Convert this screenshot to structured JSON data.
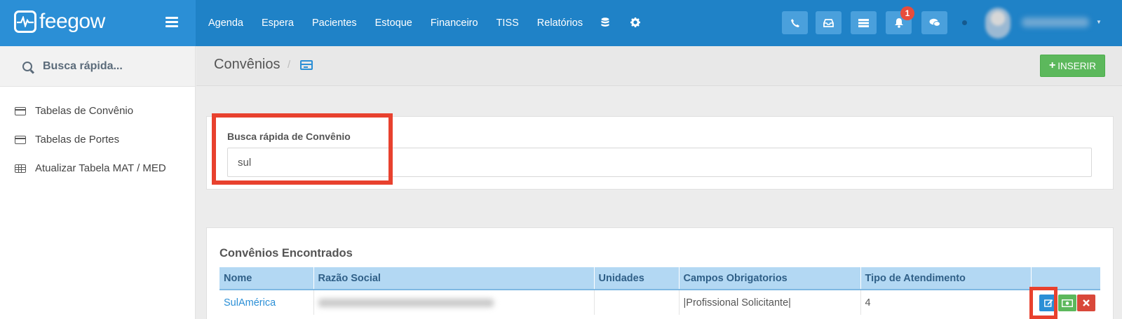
{
  "app": {
    "logo_text": "feegow"
  },
  "nav": {
    "items": [
      "Agenda",
      "Espera",
      "Pacientes",
      "Estoque",
      "Financeiro",
      "TISS",
      "Relatórios"
    ],
    "icons": [
      "database-icon",
      "gear-icon"
    ]
  },
  "topbar": {
    "buttons": [
      "phone-icon",
      "inbox-icon",
      "list-icon",
      "bell-icon",
      "chat-icon"
    ],
    "notification_count": "1"
  },
  "sidebar": {
    "search_placeholder": "Busca rápida...",
    "items": [
      {
        "label": "Tabelas de Convênio",
        "icon": "credit-card-icon"
      },
      {
        "label": "Tabelas de Portes",
        "icon": "credit-card-icon"
      },
      {
        "label": "Atualizar Tabela MAT / MED",
        "icon": "table-icon"
      }
    ]
  },
  "header": {
    "title": "Convênios",
    "separator": "/",
    "insert_label": "INSERIR",
    "insert_icon": "+"
  },
  "search": {
    "label": "Busca rápida de Convênio",
    "value": "sul"
  },
  "results": {
    "title": "Convênios Encontrados",
    "columns": [
      "Nome",
      "Razão Social",
      "Unidades",
      "Campos Obrigatorios",
      "Tipo de Atendimento",
      ""
    ],
    "rows": [
      {
        "nome": "SulAmérica",
        "razao_social": "",
        "unidades": "",
        "campos": "|Profissional Solicitante|",
        "tipo": "4"
      }
    ]
  },
  "colors": {
    "topbar": "#1f82c7",
    "brand": "#2b8fd6",
    "highlight": "#e8412e",
    "insert": "#5cb85c"
  }
}
